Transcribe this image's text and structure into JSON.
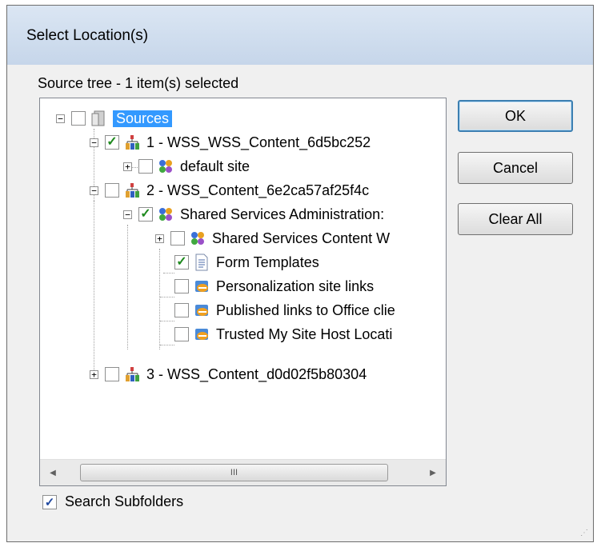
{
  "dialog": {
    "title": "Select Location(s)",
    "tree_label": "Source tree - 1 item(s) selected",
    "buttons": {
      "ok": "OK",
      "cancel": "Cancel",
      "clear_all": "Clear All"
    },
    "search_subfolders": {
      "label": "Search Subfolders",
      "checked": true
    }
  },
  "tree": [
    {
      "label": "Sources",
      "expander": "−",
      "checked": false,
      "selected": true,
      "icon": "server-icon"
    },
    {
      "label": "1 - WSS_WSS_Content_6d5bc252",
      "expander": "−",
      "checked": true,
      "icon": "database-icon"
    },
    {
      "label": "default site",
      "expander": "+",
      "checked": false,
      "icon": "site-icon"
    },
    {
      "label": "2 - WSS_Content_6e2ca57af25f4c",
      "expander": "−",
      "checked": false,
      "icon": "database-icon"
    },
    {
      "label": "Shared Services Administration:",
      "expander": "−",
      "checked": true,
      "icon": "site-icon"
    },
    {
      "label": "Shared Services Content W",
      "expander": "+",
      "checked": false,
      "icon": "site-icon"
    },
    {
      "label": "Form Templates",
      "expander": "",
      "checked": true,
      "icon": "document-icon"
    },
    {
      "label": "Personalization site links",
      "expander": "",
      "checked": false,
      "icon": "link-list-icon"
    },
    {
      "label": "Published links to Office clie",
      "expander": "",
      "checked": false,
      "icon": "link-list-icon"
    },
    {
      "label": "Trusted My Site Host Locati",
      "expander": "",
      "checked": false,
      "icon": "link-list-icon"
    },
    {
      "label": "3 - WSS_Content_d0d02f5b80304",
      "expander": "+",
      "checked": false,
      "icon": "database-icon"
    }
  ],
  "scrollbar": {
    "thumb_grip": "III",
    "left_arrow": "◀",
    "right_arrow": "▶"
  },
  "resize_grip": "⋰",
  "check_mark": "✓"
}
